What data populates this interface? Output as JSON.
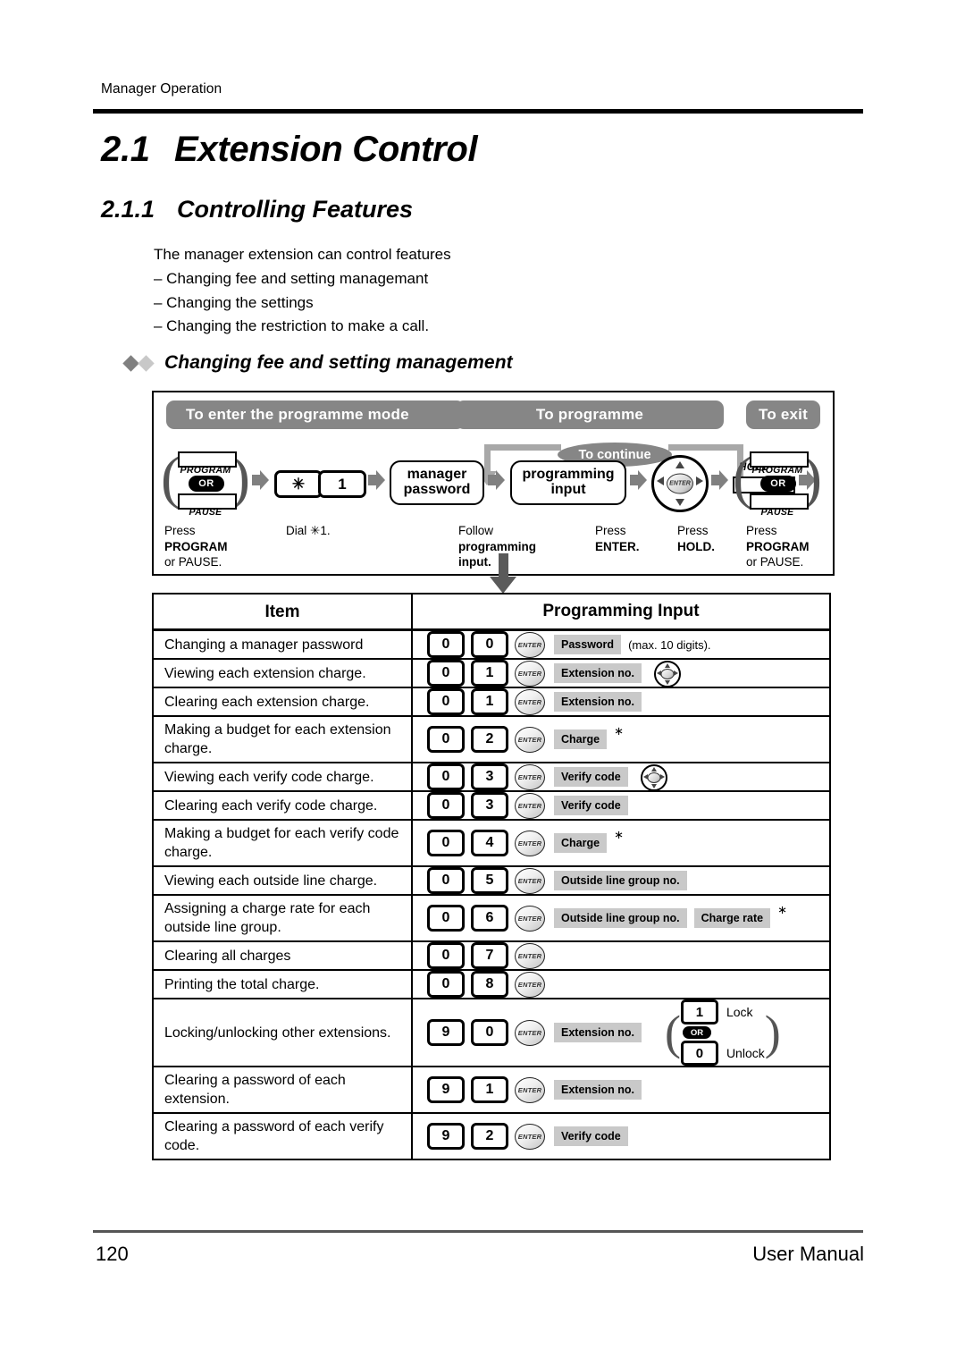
{
  "header": {
    "running_head": "Manager Operation"
  },
  "titles": {
    "section_number": "2.1",
    "section_title": "Extension Control",
    "subsection_number": "2.1.1",
    "subsection_title": "Controlling Features"
  },
  "intro": {
    "lead": "The manager extension can control features",
    "bullets": [
      "– Changing fee and setting managemant",
      "– Changing the settings",
      "– Changing the restriction to make a call."
    ]
  },
  "diamond_heading": "Changing fee and setting management",
  "flow": {
    "pills": {
      "enter_mode": "To enter the programme mode",
      "to_programme": "To programme",
      "to_exit": "To exit",
      "to_continue": "To continue"
    },
    "steps": [
      {
        "key_top": "PROGRAM",
        "key_or": "OR",
        "key_bottom": "PAUSE",
        "caption_line1": "Press",
        "caption_line2": "PROGRAM",
        "caption_line3": "or PAUSE."
      },
      {
        "keys": [
          "✳",
          "1"
        ],
        "caption_line1": "Dial ✳1."
      },
      {
        "box_line1": "manager",
        "box_line2": "password"
      },
      {
        "box_line1": "programming",
        "box_line2": "input",
        "caption_line1": "Follow",
        "caption_line2": "programming",
        "caption_line3": "input."
      },
      {
        "icon": "navigator-enter",
        "icon_label": "ENTER",
        "caption_line1": "Press",
        "caption_line2": "ENTER."
      },
      {
        "key_label": "HOLD",
        "caption_line1": "Press",
        "caption_line2": "HOLD."
      },
      {
        "key_top": "PROGRAM",
        "key_or": "OR",
        "key_bottom": "PAUSE",
        "caption_line1": "Press",
        "caption_line2": "PROGRAM",
        "caption_line3": "or PAUSE."
      }
    ]
  },
  "table": {
    "columns": [
      "Item",
      "Programming Input"
    ],
    "rows": [
      {
        "item": "Changing a manager password",
        "digits": [
          "0",
          "0"
        ],
        "enter": "ENTER",
        "tags": [
          "Password"
        ],
        "note": "(max. 10 digits).",
        "asterisk": false,
        "navigator": false
      },
      {
        "item": "Viewing each extension charge.",
        "digits": [
          "0",
          "1"
        ],
        "enter": "ENTER",
        "tags": [
          "Extension no."
        ],
        "note": "",
        "asterisk": false,
        "navigator": true
      },
      {
        "item": "Clearing each extension charge.",
        "digits": [
          "0",
          "1"
        ],
        "enter": "ENTER",
        "tags": [
          "Extension no."
        ],
        "note": "",
        "asterisk": false,
        "navigator": false
      },
      {
        "item": "Making a budget for each extension charge.",
        "digits": [
          "0",
          "2"
        ],
        "enter": "ENTER",
        "tags": [
          "Charge"
        ],
        "note": "",
        "asterisk": true,
        "navigator": false
      },
      {
        "item": "Viewing each verify code charge.",
        "digits": [
          "0",
          "3"
        ],
        "enter": "ENTER",
        "tags": [
          "Verify code"
        ],
        "note": "",
        "asterisk": false,
        "navigator": true
      },
      {
        "item": "Clearing each verify code charge.",
        "digits": [
          "0",
          "3"
        ],
        "enter": "ENTER",
        "tags": [
          "Verify code"
        ],
        "note": "",
        "asterisk": false,
        "navigator": false
      },
      {
        "item": "Making a budget for each verify code charge.",
        "digits": [
          "0",
          "4"
        ],
        "enter": "ENTER",
        "tags": [
          "Charge"
        ],
        "note": "",
        "asterisk": true,
        "navigator": false
      },
      {
        "item": "Viewing each outside line charge.",
        "digits": [
          "0",
          "5"
        ],
        "enter": "ENTER",
        "tags": [
          "Outside line group no."
        ],
        "note": "",
        "asterisk": false,
        "navigator": false
      },
      {
        "item": "Assigning a charge rate for each outside line group.",
        "digits": [
          "0",
          "6"
        ],
        "enter": "ENTER",
        "tags": [
          "Outside line group no.",
          "Charge rate"
        ],
        "note": "",
        "asterisk": true,
        "navigator": false
      },
      {
        "item": "Clearing all charges",
        "digits": [
          "0",
          "7"
        ],
        "enter": "ENTER",
        "tags": [],
        "note": "",
        "asterisk": false,
        "navigator": false
      },
      {
        "item": "Printing the total charge.",
        "digits": [
          "0",
          "8"
        ],
        "enter": "ENTER",
        "tags": [],
        "note": "",
        "asterisk": false,
        "navigator": false
      },
      {
        "item": "Locking/unlocking other extensions.",
        "digits": [
          "9",
          "0"
        ],
        "enter": "ENTER",
        "tags": [
          "Extension no."
        ],
        "note": "",
        "asterisk": false,
        "navigator": false,
        "lock_group": {
          "lock_key": "1",
          "lock_label": "Lock",
          "or_label": "OR",
          "unlock_key": "0",
          "unlock_label": "Unlock"
        }
      },
      {
        "item": "Clearing a password of each extension.",
        "digits": [
          "9",
          "1"
        ],
        "enter": "ENTER",
        "tags": [
          "Extension no."
        ],
        "note": "",
        "asterisk": false,
        "navigator": false
      },
      {
        "item": "Clearing a password of each verify code.",
        "digits": [
          "9",
          "2"
        ],
        "enter": "ENTER",
        "tags": [
          "Verify code"
        ],
        "note": "",
        "asterisk": false,
        "navigator": false
      }
    ]
  },
  "footer": {
    "page_number": "120",
    "manual_label": "User Manual"
  },
  "colors": {
    "pill_gray": "#868686",
    "tag_gray": "#c9c9c9",
    "arrow_gray": "#808080",
    "rule_black": "#000000"
  }
}
